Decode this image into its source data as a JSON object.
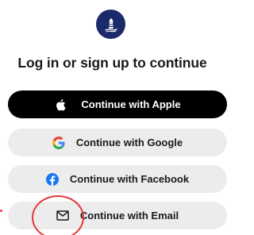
{
  "title": "Log in or sign up to continue",
  "buttons": {
    "apple": "Continue with Apple",
    "google": "Continue with Google",
    "facebook": "Continue with Facebook",
    "email": "Continue with Email"
  },
  "icons": {
    "logo": "lighthouse-logo-icon",
    "apple": "apple-icon",
    "google": "google-icon",
    "facebook": "facebook-icon",
    "email": "mail-icon"
  },
  "colors": {
    "logo_bg": "#1b2a6b",
    "apple_bg": "#000000",
    "secondary_bg": "#ececec",
    "annotation": "#e8353b",
    "facebook_blue": "#1877f2"
  }
}
